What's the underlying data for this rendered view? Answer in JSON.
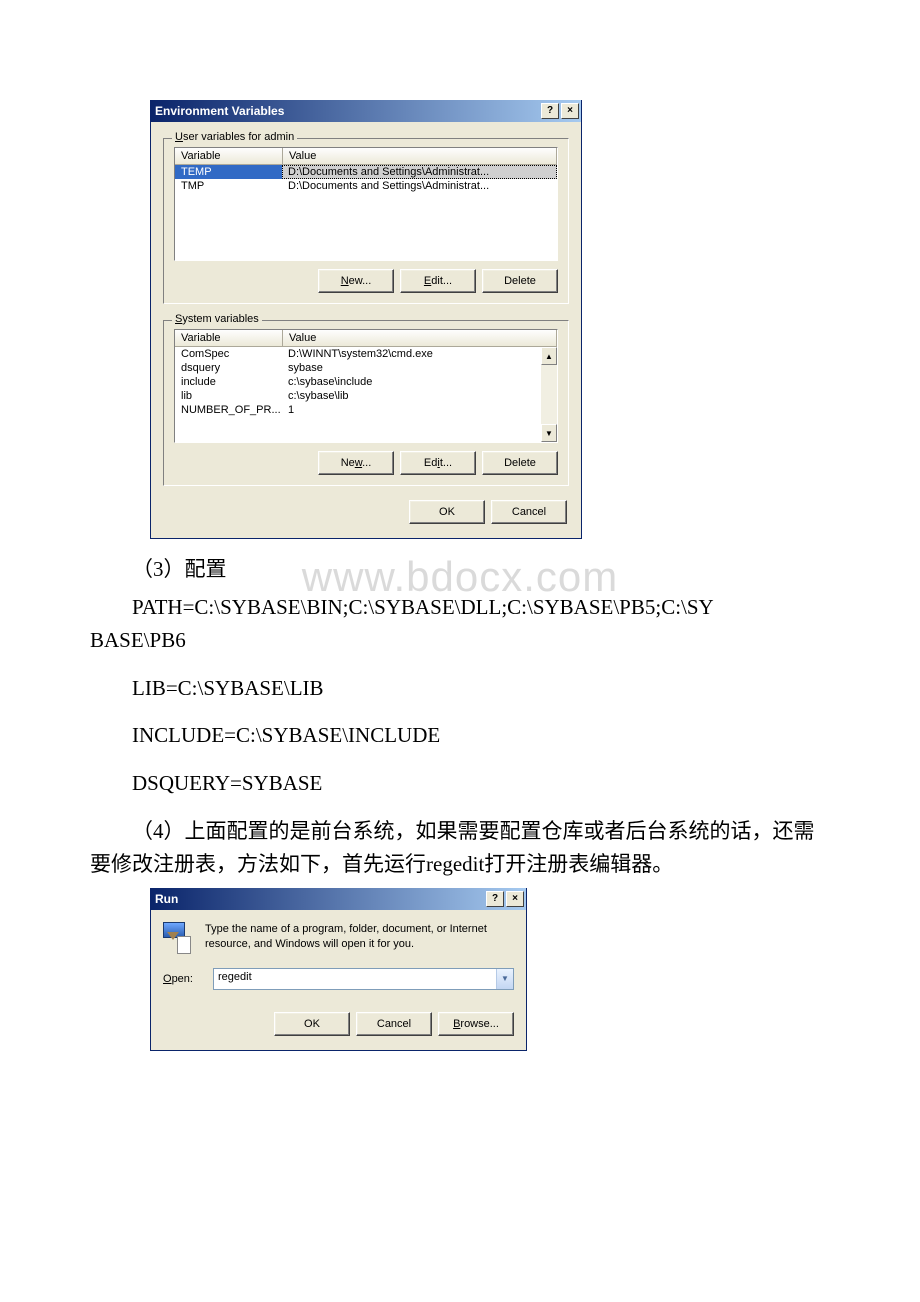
{
  "env_dialog": {
    "title": "Environment Variables",
    "user_group_label": "User variables for admin",
    "system_group_label": "System variables",
    "col_variable": "Variable",
    "col_value": "Value",
    "user_vars": [
      {
        "name": "TEMP",
        "value": "D:\\Documents and Settings\\Administrat..."
      },
      {
        "name": "TMP",
        "value": "D:\\Documents and Settings\\Administrat..."
      }
    ],
    "system_vars": [
      {
        "name": "ComSpec",
        "value": "D:\\WINNT\\system32\\cmd.exe"
      },
      {
        "name": "dsquery",
        "value": "sybase"
      },
      {
        "name": "include",
        "value": "c:\\sybase\\include"
      },
      {
        "name": "lib",
        "value": "c:\\sybase\\lib"
      },
      {
        "name": "NUMBER_OF_PR...",
        "value": "1"
      }
    ],
    "btn_new": "New...",
    "btn_edit": "Edit...",
    "btn_delete": "Delete",
    "btn_ok": "OK",
    "btn_cancel": "Cancel"
  },
  "watermark": "www.bdocx.com",
  "para1": "（3）配置",
  "para2a": "PATH=C:\\SYBASE\\BIN;C:\\SYBASE\\DLL;C:\\SYBASE\\PB5;C:\\SY",
  "para2b": "BASE\\PB6",
  "para3": "LIB=C:\\SYBASE\\LIB",
  "para4": "INCLUDE=C:\\SYBASE\\INCLUDE",
  "para5": "DSQUERY=SYBASE",
  "para6": "（4）上面配置的是前台系统，如果需要配置仓库或者后台系统的话，还需要修改注册表，方法如下，首先运行regedit打开注册表编辑器。",
  "run_dialog": {
    "title": "Run",
    "desc": "Type the name of a program, folder, document, or Internet resource, and Windows will open it for you.",
    "open_label": "Open:",
    "open_value": "regedit",
    "btn_ok": "OK",
    "btn_cancel": "Cancel",
    "btn_browse": "Browse..."
  }
}
